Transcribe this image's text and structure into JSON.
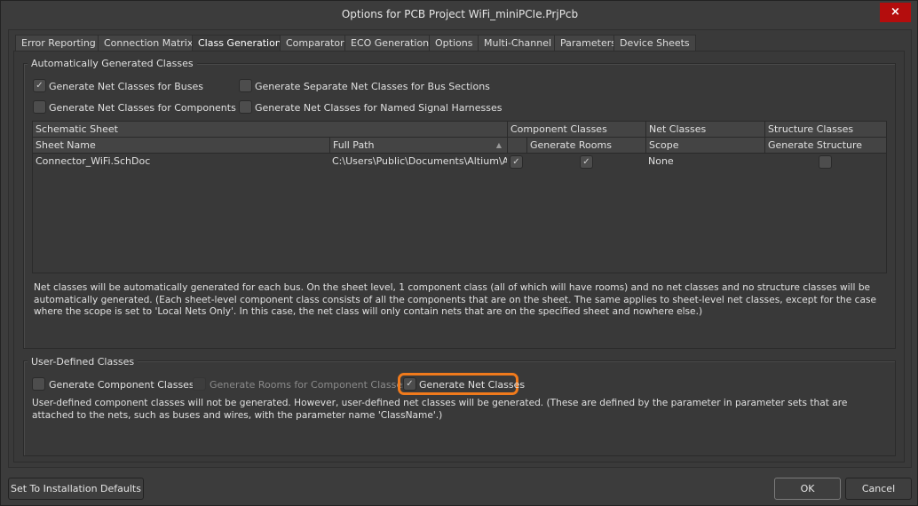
{
  "window": {
    "title": "Options for PCB Project WiFi_miniPCIe.PrjPcb",
    "close_icon": "×"
  },
  "tabs": [
    "Error Reporting",
    "Connection Matrix",
    "Class Generation",
    "Comparator",
    "ECO Generation",
    "Options",
    "Multi-Channel",
    "Parameters",
    "Device Sheets"
  ],
  "active_tab": "Class Generation",
  "auto": {
    "title": "Automatically Generated Classes",
    "options": [
      {
        "label": "Generate Net Classes for Buses",
        "checked": true
      },
      {
        "label": "Generate Separate Net Classes for Bus Sections",
        "checked": false
      },
      {
        "label": "Generate Net Classes for Components",
        "checked": false
      },
      {
        "label": "Generate Net Classes for Named Signal Harnesses",
        "checked": false
      }
    ],
    "table": {
      "group_headers": [
        "Schematic Sheet",
        "Component Classes",
        "Net Classes",
        "Structure Classes"
      ],
      "headers": [
        "Sheet Name",
        "Full Path",
        "",
        "Generate Rooms",
        "Scope",
        "Generate Structure"
      ],
      "rows": [
        {
          "sheet": "Connector_WiFi.SchDoc",
          "path": "C:\\Users\\Public\\Documents\\Altium\\AD",
          "component": true,
          "rooms": true,
          "scope": "None",
          "structure": false
        }
      ]
    },
    "description": "Net classes will be automatically generated for each bus. On the sheet level, 1 component class (all of which will have rooms) and no net classes and no structure classes will be automatically generated. (Each sheet-level component class consists of all the components that are on the sheet. The same applies to sheet-level net classes, except for the case where the scope is set to 'Local Nets Only'. In this case, the net class will only contain nets that are on the specified sheet and nowhere else.)"
  },
  "user": {
    "title": "User-Defined Classes",
    "options": [
      {
        "label": "Generate Component Classes",
        "checked": false
      },
      {
        "label": "Generate Rooms for Component Classes",
        "checked": false,
        "disabled": true
      },
      {
        "label": "Generate Net Classes",
        "checked": true
      }
    ],
    "description": "User-defined component classes will not be generated. However, user-defined net classes will be generated. (These are defined by the parameter in parameter sets that are attached to the nets, such as buses and wires, with the parameter name 'ClassName'.)"
  },
  "buttons": {
    "defaults": "Set To Installation Defaults",
    "ok": "OK",
    "cancel": "Cancel"
  },
  "check_glyph": "✓",
  "colors": {
    "highlight": "#f07a1c",
    "close": "#b40d0d"
  }
}
